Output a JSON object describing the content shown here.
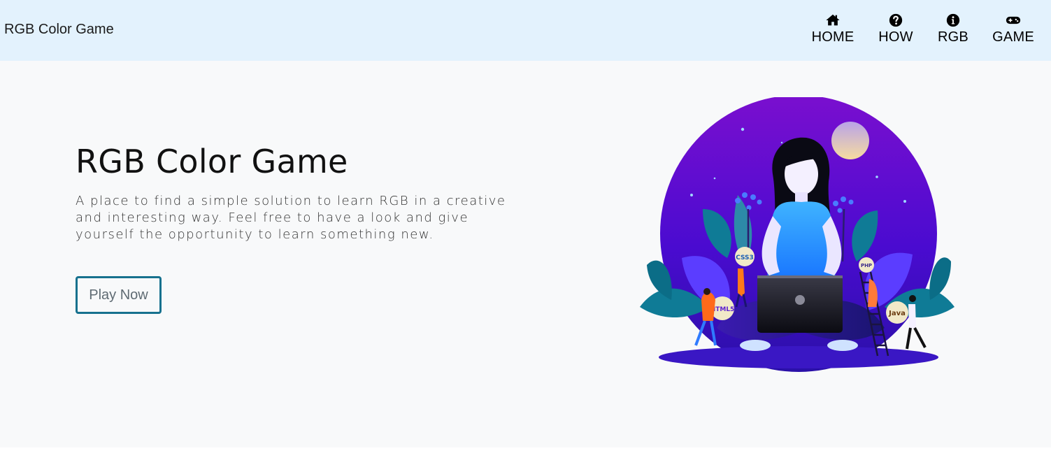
{
  "navbar": {
    "brand": "RGB Color Game",
    "items": [
      {
        "label": "HOME",
        "icon": "home-icon"
      },
      {
        "label": "HOW",
        "icon": "question-circle-icon"
      },
      {
        "label": "RGB",
        "icon": "info-circle-icon"
      },
      {
        "label": "GAME",
        "icon": "gamepad-icon"
      }
    ]
  },
  "hero": {
    "title": "RGB Color Game",
    "description": "A place to find a simple solution to learn RGB in a creative and interesting way. Feel free to have a look and give yourself the opportunity to learn something new.",
    "cta_label": "Play Now"
  },
  "illustration": {
    "badges": [
      "CSS3",
      "PHP",
      "HTML5",
      "Java"
    ]
  },
  "colors": {
    "navbar_bg": "#e3f2fd",
    "hero_bg": "#f8f9fa",
    "button_border": "#17718e",
    "illustration_purple": "#5b0fd0",
    "illustration_teal": "#0f7b96"
  }
}
